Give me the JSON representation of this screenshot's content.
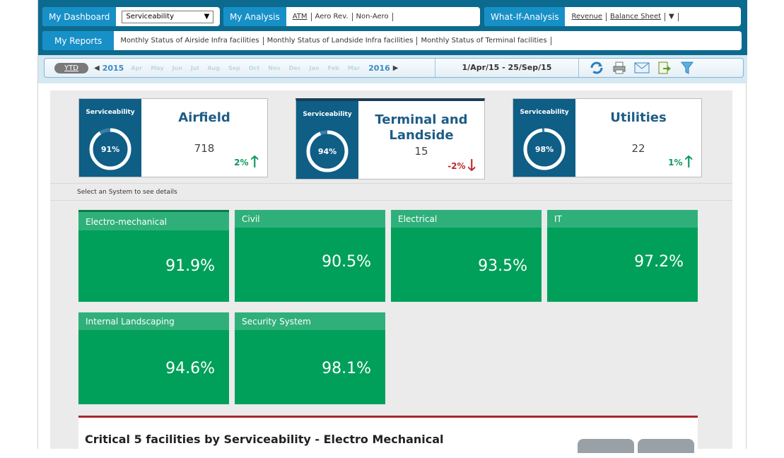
{
  "nav": {
    "dashboard_label": "My Dashboard",
    "dashboard_select": "Serviceability",
    "analysis_label": "My Analysis",
    "analysis_links": [
      "ATM",
      "Aero Rev.",
      "Non-Aero"
    ],
    "whatif_label": "What-If-Analysis",
    "whatif_links": [
      "Revenue",
      "Balance Sheet"
    ],
    "whatif_more": "▼",
    "reports_label": "My Reports",
    "reports_links": [
      "Monthly Status of Airside Infra facilities",
      "Monthly Status of Landside Infra facilities",
      "Monthly Status of Terminal facilities"
    ]
  },
  "timebar": {
    "ytd": "YTD",
    "year_start": "2015",
    "year_end": "2016",
    "months": [
      "Apr",
      "May",
      "Jun",
      "Jul",
      "Aug",
      "Sep",
      "Oct",
      "Nov",
      "Dec",
      "Jan",
      "Feb",
      "Mar"
    ],
    "date_range": "1/Apr/15 - 25/Sep/15",
    "tools": [
      "refresh-icon",
      "print-icon",
      "email-icon",
      "export-icon",
      "filter-icon"
    ]
  },
  "kpis": [
    {
      "label": "Serviceability",
      "title_line1": "Airfield",
      "title_line2": "",
      "pct": 91,
      "pct_text": "91%",
      "count": "718",
      "delta": "2%",
      "direction": "up"
    },
    {
      "label": "Serviceability",
      "title_line1": "Terminal and",
      "title_line2": "Landside",
      "pct": 94,
      "pct_text": "94%",
      "count": "15",
      "delta": "-2%",
      "direction": "down"
    },
    {
      "label": "Serviceability",
      "title_line1": "Utilities",
      "title_line2": "",
      "pct": 98,
      "pct_text": "98%",
      "count": "22",
      "delta": "1%",
      "direction": "up"
    }
  ],
  "hint": "Select an System to see details",
  "systems": [
    {
      "name": "Electro-mechanical",
      "value": "91.9%"
    },
    {
      "name": "Civil",
      "value": "90.5%"
    },
    {
      "name": "Electrical",
      "value": "93.5%"
    },
    {
      "name": "IT",
      "value": "97.2%"
    },
    {
      "name": "Internal Landscaping",
      "value": "94.6%"
    },
    {
      "name": "Security System",
      "value": "98.1%"
    }
  ],
  "critical_title": "Critical 5 facilities by Serviceability - Electro Mechanical",
  "colors": {
    "brand": "#0d6a8f",
    "accent": "#1790c7",
    "kpi_panel": "#0e5e86",
    "tile": "#00a05a",
    "tile_head": "#2fb07a",
    "up": "#0a9a5a",
    "down": "#c0282d"
  }
}
